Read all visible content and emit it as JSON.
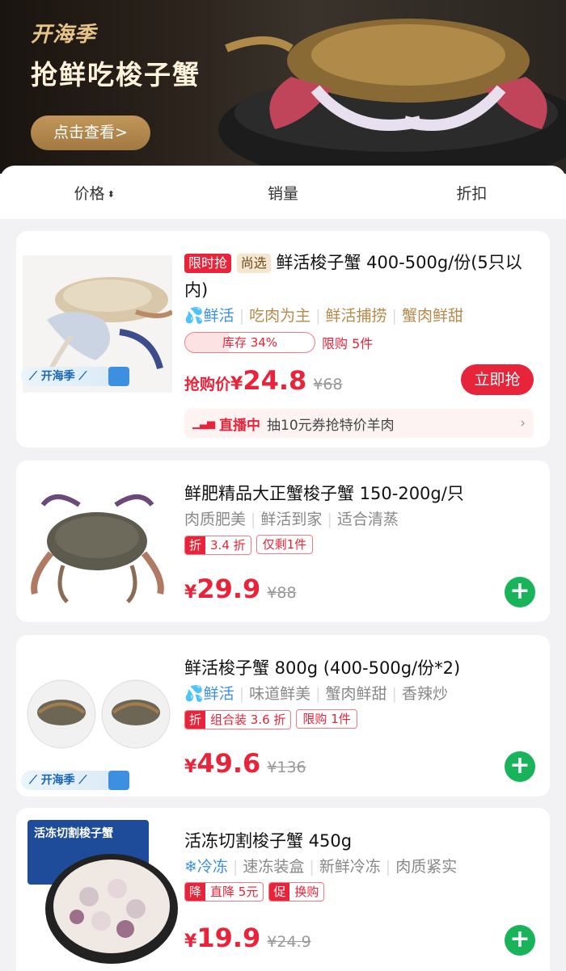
{
  "banner": {
    "brand": "开海季",
    "headline": "抢鲜吃梭子蟹",
    "cta": "点击查看>"
  },
  "sort": {
    "price": "价格",
    "sales": "销量",
    "discount": "折扣"
  },
  "products": [
    {
      "tag_flash": "限时抢",
      "tag_select": "尚选",
      "title": "鲜活梭子蟹 400-500g/份(5只以内)",
      "attr_fresh": "鲜活",
      "attrs": [
        "吃肉为主",
        "鲜活捕捞",
        "蟹肉鲜甜"
      ],
      "stock_label": "库存 34%",
      "stock_fraction": 0.34,
      "limit": "限购 5件",
      "price_prefix": "抢购价",
      "price": "24.8",
      "old_price": "¥68",
      "buy_button": "立即抢",
      "live_label": "直播中",
      "live_text": "抽10元券抢特价羊肉",
      "badge": "开海季"
    },
    {
      "title": "鲜肥精品大正蟹梭子蟹 150-200g/只",
      "attrs": [
        "肉质肥美",
        "鲜活到家",
        "适合清蒸"
      ],
      "discount_l": "折",
      "discount_r": "3.4 折",
      "remain": "仅剩1件",
      "price": "29.9",
      "old_price": "¥88"
    },
    {
      "title": "鲜活梭子蟹 800g (400-500g/份*2)",
      "attr_fresh": "鲜活",
      "attrs": [
        "味道鲜美",
        "蟹肉鲜甜",
        "香辣炒"
      ],
      "discount_l": "折",
      "discount_r": "组合装 3.6 折",
      "limit": "限购 1件",
      "price": "49.6",
      "old_price": "¥136",
      "badge": "开海季"
    },
    {
      "title": "活冻切割梭子蟹 450g",
      "attr_frozen": "冷冻",
      "attrs": [
        "速冻装盒",
        "新鲜冷冻",
        "肉质紧实"
      ],
      "promo1_l": "降",
      "promo1_r": "直降 5元",
      "promo2_l": "促",
      "promo2_r": "换购",
      "price": "19.9",
      "old_price": "¥24.9",
      "box_label": "活冻切割梭子蟹"
    }
  ],
  "currency": "¥",
  "colors": {
    "accent_red": "#e8243a",
    "add_green": "#19b45a",
    "fresh_blue": "#3d8fe0",
    "banner_gold": "#e9c48a"
  }
}
